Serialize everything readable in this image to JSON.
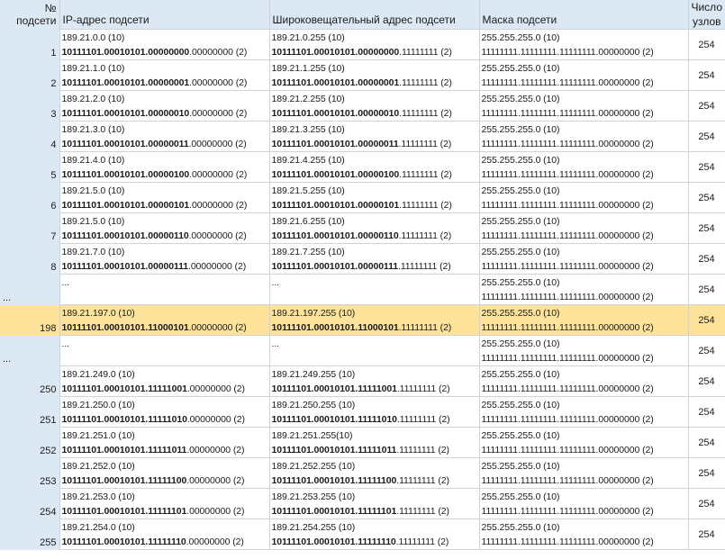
{
  "headers": {
    "num": "№ подсети",
    "ip": "IP-адрес подсети",
    "broadcast": "Широковещательный адрес подсети",
    "mask": "Маска подсети",
    "hosts_line1": "Число",
    "hosts_line2": "узлов"
  },
  "rows": [
    {
      "num": "1",
      "ip_dec": "189.21.0.0 (10)",
      "ip_bold": "10111101.00010101.00000000",
      "ip_rest": ".00000000 (2)",
      "bc_dec": "189.21.0.255 (10)",
      "bc_bold": "10111101.00010101.00000000",
      "bc_rest": ".11111111 (2)",
      "mask_dec": "255.255.255.0 (10)",
      "mask_bin": "11111111.11111111.11111111.00000000 (2)",
      "hosts": "254"
    },
    {
      "num": "2",
      "ip_dec": "189.21.1.0 (10)",
      "ip_bold": "10111101.00010101.00000001",
      "ip_rest": ".00000000 (2)",
      "bc_dec": "189.21.1.255 (10)",
      "bc_bold": "10111101.00010101.00000001",
      "bc_rest": ".11111111 (2)",
      "mask_dec": "255.255.255.0 (10)",
      "mask_bin": "11111111.11111111.11111111.00000000 (2)",
      "hosts": "254"
    },
    {
      "num": "3",
      "ip_dec": "189.21.2.0 (10)",
      "ip_bold": "10111101.00010101.00000010",
      "ip_rest": ".00000000 (2)",
      "bc_dec": "189.21.2.255 (10)",
      "bc_bold": "10111101.00010101.00000010",
      "bc_rest": ".11111111 (2)",
      "mask_dec": "255.255.255.0 (10)",
      "mask_bin": "11111111.11111111.11111111.00000000 (2)",
      "hosts": "254"
    },
    {
      "num": "4",
      "ip_dec": "189.21.3.0 (10)",
      "ip_bold": "10111101.00010101.00000011",
      "ip_rest": ".00000000 (2)",
      "bc_dec": "189.21.3.255 (10)",
      "bc_bold": "10111101.00010101.00000011",
      "bc_rest": ".11111111 (2)",
      "mask_dec": "255.255.255.0 (10)",
      "mask_bin": "11111111.11111111.11111111.00000000 (2)",
      "hosts": "254"
    },
    {
      "num": "5",
      "ip_dec": "189.21.4.0 (10)",
      "ip_bold": "10111101.00010101.00000100",
      "ip_rest": ".00000000 (2)",
      "bc_dec": "189.21.4.255 (10)",
      "bc_bold": "10111101.00010101.00000100",
      "bc_rest": ".11111111 (2)",
      "mask_dec": "255.255.255.0 (10)",
      "mask_bin": "11111111.11111111.11111111.00000000 (2)",
      "hosts": "254"
    },
    {
      "num": "6",
      "ip_dec": "189.21.5.0 (10)",
      "ip_bold": "10111101.00010101.00000101",
      "ip_rest": ".00000000 (2)",
      "bc_dec": "189.21.5.255 (10)",
      "bc_bold": "10111101.00010101.00000101",
      "bc_rest": ".11111111 (2)",
      "mask_dec": "255.255.255.0 (10)",
      "mask_bin": "11111111.11111111.11111111.00000000 (2)",
      "hosts": "254"
    },
    {
      "num": "7",
      "ip_dec": "189.21.5.0 (10)",
      "ip_bold": "10111101.00010101.00000110",
      "ip_rest": ".00000000 (2)",
      "bc_dec": "189.21.6.255 (10)",
      "bc_bold": "10111101.00010101.00000110",
      "bc_rest": ".11111111 (2)",
      "mask_dec": "255.255.255.0 (10)",
      "mask_bin": "11111111.11111111.11111111.00000000 (2)",
      "hosts": "254"
    },
    {
      "num": "8",
      "ip_dec": "189.21.7.0 (10)",
      "ip_bold": "10111101.00010101.00000111",
      "ip_rest": ".00000000 (2)",
      "bc_dec": "189.21.7.255 (10)",
      "bc_bold": "10111101.00010101.00000111",
      "bc_rest": ".11111111 (2)",
      "mask_dec": "255.255.255.0 (10)",
      "mask_bin": "11111111.11111111.11111111.00000000 (2)",
      "hosts": "254"
    },
    {
      "num": "...",
      "ip_dec": "",
      "ip_bold": "",
      "ip_rest": "...",
      "bc_dec": "",
      "bc_bold": "",
      "bc_rest": "...",
      "mask_dec": "255.255.255.0 (10)",
      "mask_bin": "11111111.11111111.11111111.00000000 (2)",
      "hosts": "254",
      "ellipsis": true
    },
    {
      "num": "198",
      "ip_dec": "189.21.197.0 (10)",
      "ip_bold": "10111101.00010101.11000101",
      "ip_rest": ".00000000 (2)",
      "bc_dec": "189.21.197.255 (10)",
      "bc_bold": "10111101.00010101.11000101",
      "bc_rest": ".11111111 (2)",
      "mask_dec": "255.255.255.0 (10)",
      "mask_bin": "11111111.11111111.11111111.00000000 (2)",
      "hosts": "254",
      "highlight": true
    },
    {
      "num": "...",
      "ip_dec": "",
      "ip_bold": "",
      "ip_rest": "...",
      "bc_dec": "",
      "bc_bold": "",
      "bc_rest": "...",
      "mask_dec": "255.255.255.0 (10)",
      "mask_bin": "11111111.11111111.11111111.00000000 (2)",
      "hosts": "254",
      "ellipsis": true
    },
    {
      "num": "250",
      "ip_dec": "189.21.249.0 (10)",
      "ip_bold": "10111101.00010101.11111001",
      "ip_rest": ".00000000 (2)",
      "bc_dec": "189.21.249.255 (10)",
      "bc_bold": "10111101.00010101.11111001",
      "bc_rest": ".11111111 (2)",
      "mask_dec": "255.255.255.0 (10)",
      "mask_bin": "11111111.11111111.11111111.00000000 (2)",
      "hosts": "254"
    },
    {
      "num": "251",
      "ip_dec": "189.21.250.0 (10)",
      "ip_bold": "10111101.00010101.11111010",
      "ip_rest": ".00000000 (2)",
      "bc_dec": "189.21.250.255 (10)",
      "bc_bold": "10111101.00010101.11111010",
      "bc_rest": ".11111111 (2)",
      "mask_dec": "255.255.255.0 (10)",
      "mask_bin": "11111111.11111111.11111111.00000000 (2)",
      "hosts": "254"
    },
    {
      "num": "252",
      "ip_dec": "189.21.251.0 (10)",
      "ip_bold": "10111101.00010101.11111011",
      "ip_rest": ".00000000 (2)",
      "bc_dec": "189.21.251.255(10)",
      "bc_bold": "10111101.00010101.11111011",
      "bc_rest": ".11111111 (2)",
      "mask_dec": "255.255.255.0 (10)",
      "mask_bin": "11111111.11111111.11111111.00000000 (2)",
      "hosts": "254"
    },
    {
      "num": "253",
      "ip_dec": "189.21.252.0 (10)",
      "ip_bold": "10111101.00010101.11111100",
      "ip_rest": ".00000000 (2)",
      "bc_dec": "189.21.252.255 (10)",
      "bc_bold": "10111101.00010101.11111100",
      "bc_rest": ".11111111 (2)",
      "mask_dec": "255.255.255.0 (10)",
      "mask_bin": "11111111.11111111.11111111.00000000 (2)",
      "hosts": "254"
    },
    {
      "num": "254",
      "ip_dec": "189.21.253.0 (10)",
      "ip_bold": "10111101.00010101.11111101",
      "ip_rest": ".00000000 (2)",
      "bc_dec": "189.21.253.255 (10)",
      "bc_bold": "10111101.00010101.11111101",
      "bc_rest": ".11111111 (2)",
      "mask_dec": "255.255.255.0 (10)",
      "mask_bin": "11111111.11111111.11111111.00000000 (2)",
      "hosts": "254"
    },
    {
      "num": "255",
      "ip_dec": "189.21.254.0 (10)",
      "ip_bold": "10111101.00010101.11111110",
      "ip_rest": ".00000000 (2)",
      "bc_dec": "189.21.254.255 (10)",
      "bc_bold": "10111101.00010101.11111110",
      "bc_rest": ".11111111 (2)",
      "mask_dec": "255.255.255.0 (10)",
      "mask_bin": "11111111.11111111.11111111.00000000 (2)",
      "hosts": "254"
    }
  ]
}
